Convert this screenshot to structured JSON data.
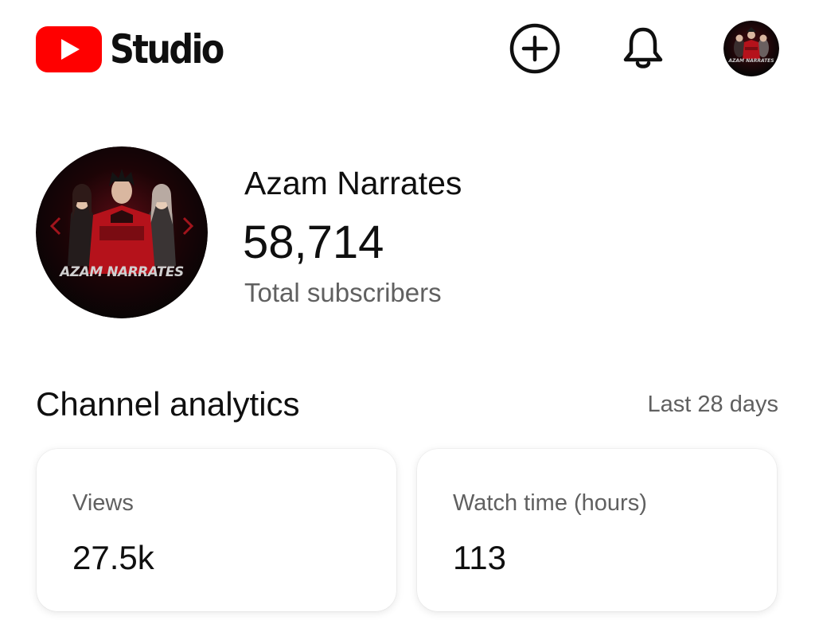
{
  "app": {
    "logo_text": "Studio",
    "brand_red": "#FF0000",
    "icons": {
      "create": "add-circle-icon",
      "notifications": "bell-icon"
    }
  },
  "header_avatar": {
    "caption": "AZAM NARRATES"
  },
  "channel": {
    "name": "Azam Narrates",
    "subscriber_count": "58,714",
    "subscriber_label": "Total subscribers",
    "avatar_caption": "AZAM NARRATES"
  },
  "analytics": {
    "title": "Channel analytics",
    "period": "Last 28 days",
    "cards": [
      {
        "label": "Views",
        "value": "27.5k"
      },
      {
        "label": "Watch time (hours)",
        "value": "113"
      }
    ]
  },
  "colors": {
    "text_primary": "#0f0f0f",
    "text_secondary": "#606060",
    "accent_red": "#c8102e"
  }
}
